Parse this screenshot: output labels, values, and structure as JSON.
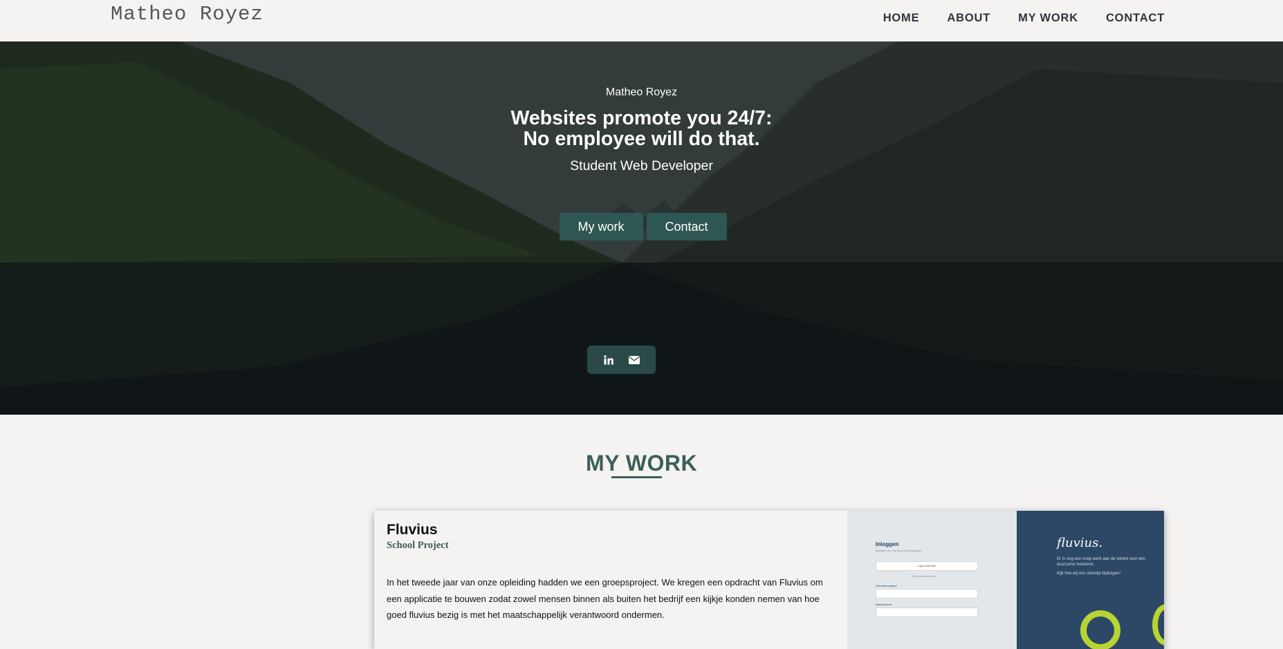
{
  "navbar": {
    "brand": "Matheo Royez",
    "links": [
      "HOME",
      "ABOUT",
      "MY WORK",
      "CONTACT"
    ]
  },
  "hero": {
    "name": "Matheo Royez",
    "title_line1": "Websites promote you 24/7:",
    "title_line2": "No employee will do that.",
    "subtitle": "Student Web Developer",
    "buttons": {
      "work": "My work",
      "contact": "Contact"
    },
    "social_icons": [
      "linkedin-icon",
      "email-icon"
    ]
  },
  "my_work": {
    "title": "MY WORK",
    "projects": [
      {
        "title": "Fluvius",
        "tag": "School Project",
        "description": "In het tweede jaar van onze opleiding hadden we een groepsproject. We kregen een opdracht van Fluvius om een applicatie te bouwen zodat zowel mensen binnen als buiten het bedrijf een kijkje konden nemen van hoe goed fluvius bezig is met het maatschappelijk verantwoord ondermen.",
        "preview": {
          "login_title": "Inloggen",
          "login_sub": "Bijdrage van ons duurzame bijdragen",
          "login_button": "Log in met eID",
          "or_text": "Of meld aan met je",
          "label_user": "Gebruikersnaam*",
          "label_pass": "Wachtwoord*",
          "logo": "fluvius.",
          "brand_line1": "Er is nog een hoop werk aan de winkel voor een duurzame toekomst.",
          "brand_line2": "Kijk hoe wij ons steentje bijdragen!"
        }
      }
    ]
  },
  "colors": {
    "accent": "#2e5753",
    "heading": "#3b5f5b",
    "background": "#f4f3f1",
    "nav_text": "#2d3440"
  }
}
